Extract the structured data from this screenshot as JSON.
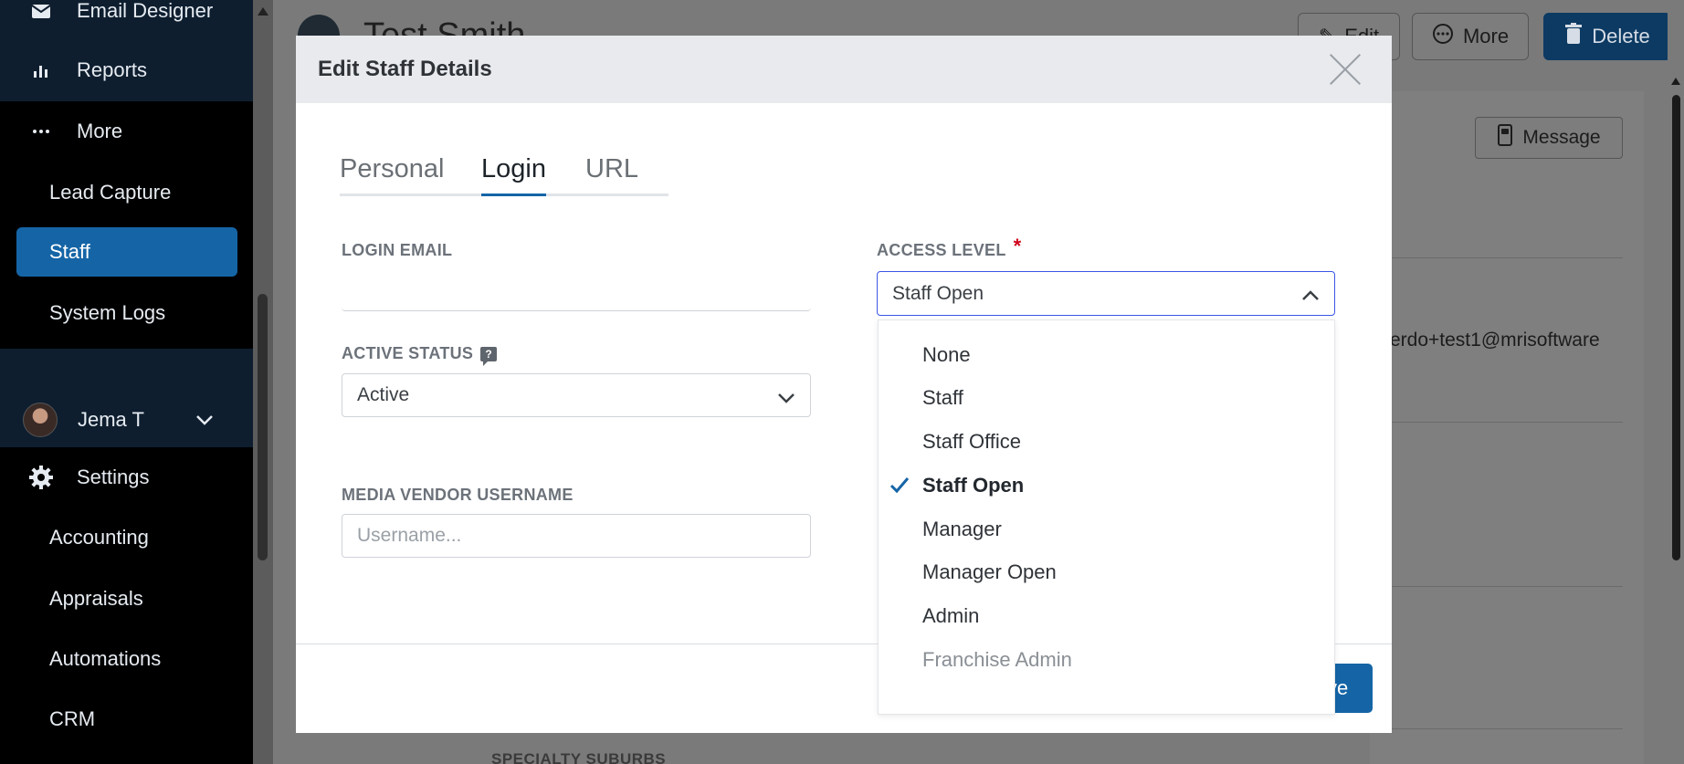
{
  "sidebar": {
    "items": [
      {
        "label": "Email Designer",
        "icon": "envelope-icon"
      },
      {
        "label": "Reports",
        "icon": "bar-chart-icon"
      },
      {
        "label": "More",
        "icon": "ellipsis-icon"
      }
    ],
    "sub_items": [
      "Lead Capture",
      "Staff",
      "System Logs"
    ],
    "active_item": "Staff",
    "user": {
      "name": "Jema T"
    },
    "settings": {
      "label": "Settings",
      "icon": "gear-icon"
    },
    "settings_items": [
      "Accounting",
      "Appraisals",
      "Automations",
      "CRM"
    ]
  },
  "background_page": {
    "title": "Test Smith",
    "edit_label": "Edit",
    "more_label": "More",
    "delete_label": "Delete",
    "message_label": "Message",
    "email_fragment": "erdo+test1@mrisoftware",
    "specialty_label": "SPECIALTY SUBURBS"
  },
  "modal": {
    "title": "Edit Staff Details",
    "tabs": [
      "Personal",
      "Login",
      "URL"
    ],
    "active_tab": "Login",
    "login_email": {
      "label": "LOGIN EMAIL",
      "value": ""
    },
    "active_status": {
      "label": "ACTIVE STATUS",
      "value": "Active"
    },
    "media_vendor": {
      "label": "MEDIA VENDOR USERNAME",
      "placeholder": "Username..."
    },
    "access_level": {
      "label": "ACCESS LEVEL",
      "required_mark": "*",
      "value": "Staff Open",
      "options": [
        "None",
        "Staff",
        "Staff Office",
        "Staff Open",
        "Manager",
        "Manager Open",
        "Admin",
        "Franchise Admin"
      ],
      "selected": "Staff Open"
    },
    "save_label_visible": "ve"
  },
  "colors": {
    "accent": "#1565a6",
    "sidebar_bg": "#000000",
    "required": "#d0021b",
    "focus_border": "#3b55e6"
  }
}
